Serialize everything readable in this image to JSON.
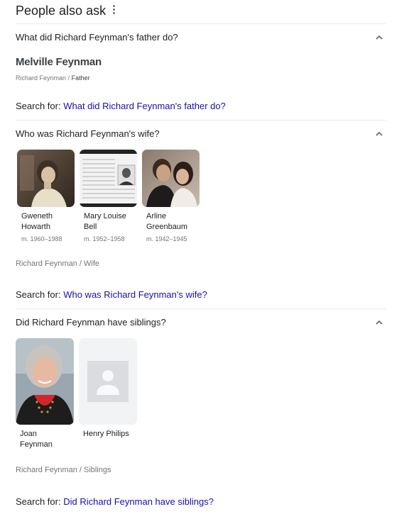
{
  "header": {
    "title": "People also ask"
  },
  "questions": [
    {
      "question": "What did Richard Feynman's father do?",
      "answer_title": "Melville Feynman",
      "breadcrumb_root": "Richard Feynman",
      "breadcrumb_sep": "/",
      "breadcrumb_leaf": "Father",
      "search_prefix": "Search for:",
      "search_link": "What did Richard Feynman's father do?"
    },
    {
      "question": "Who was Richard Feynman's wife?",
      "cards": [
        {
          "name_line1": "Gweneth",
          "name_line2": "Howarth",
          "sub": "m. 1960–1988",
          "image": "portrait-photo"
        },
        {
          "name_line1": "Mary Louise",
          "name_line2": "Bell",
          "sub": "m. 1952–1958",
          "image": "document-photo"
        },
        {
          "name_line1": "Arline",
          "name_line2": "Greenbaum",
          "sub": "m. 1942–1945",
          "image": "couple-photo"
        }
      ],
      "breadcrumb_root": "Richard Feynman",
      "breadcrumb_sep": "/",
      "breadcrumb_leaf": "Wife",
      "search_prefix": "Search for:",
      "search_link": "Who was Richard Feynman's wife?"
    },
    {
      "question": "Did Richard Feynman have siblings?",
      "cards": [
        {
          "name_line1": "Joan",
          "name_line2": "Feynman",
          "image": "portrait-photo"
        },
        {
          "name_line1": "Henry Philips",
          "name_line2": "",
          "image": "placeholder-person-icon"
        }
      ],
      "breadcrumb_root": "Richard Feynman",
      "breadcrumb_sep": "/",
      "breadcrumb_leaf": "Siblings",
      "search_prefix": "Search for:",
      "search_link": "Did Richard Feynman have siblings?"
    }
  ],
  "colors": {
    "link": "#1a0dab",
    "text": "#202124",
    "muted": "#70757a",
    "divider": "#e8eaed"
  },
  "icons": {
    "more": "more-vert-icon",
    "chevron": "chevron-up-icon",
    "placeholder": "person-placeholder-icon"
  }
}
